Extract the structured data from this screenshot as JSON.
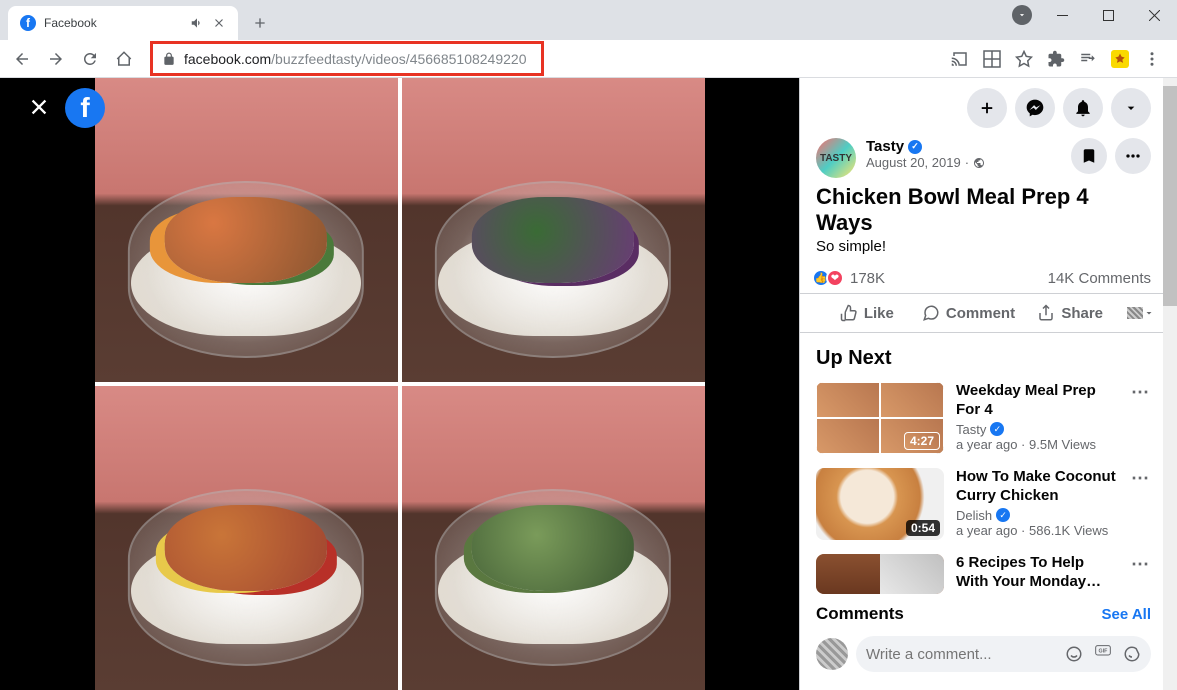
{
  "browser": {
    "tab_title": "Facebook",
    "url_domain": "facebook.com",
    "url_path": "/buzzfeedtasty/videos/456685108249220"
  },
  "post": {
    "page_name": "Tasty",
    "avatar_label": "TASTY",
    "date": "August 20, 2019",
    "title": "Chicken Bowl Meal Prep 4 Ways",
    "caption": "So simple!",
    "react_count": "178K",
    "comment_count": "14K Comments"
  },
  "actions": {
    "like": "Like",
    "comment": "Comment",
    "share": "Share"
  },
  "upnext": {
    "heading": "Up Next",
    "items": [
      {
        "title": "Weekday Meal Prep For 4",
        "source": "Tasty",
        "age": "a year ago",
        "views": "9.5M Views",
        "duration": "4:27"
      },
      {
        "title": "How To Make Coconut Curry Chicken",
        "source": "Delish",
        "age": "a year ago",
        "views": "586.1K Views",
        "duration": "0:54"
      },
      {
        "title": "6 Recipes To Help With Your Monday…",
        "source": "",
        "age": "",
        "views": "",
        "duration": ""
      }
    ]
  },
  "comments": {
    "heading": "Comments",
    "see_all": "See All",
    "placeholder": "Write a comment..."
  }
}
